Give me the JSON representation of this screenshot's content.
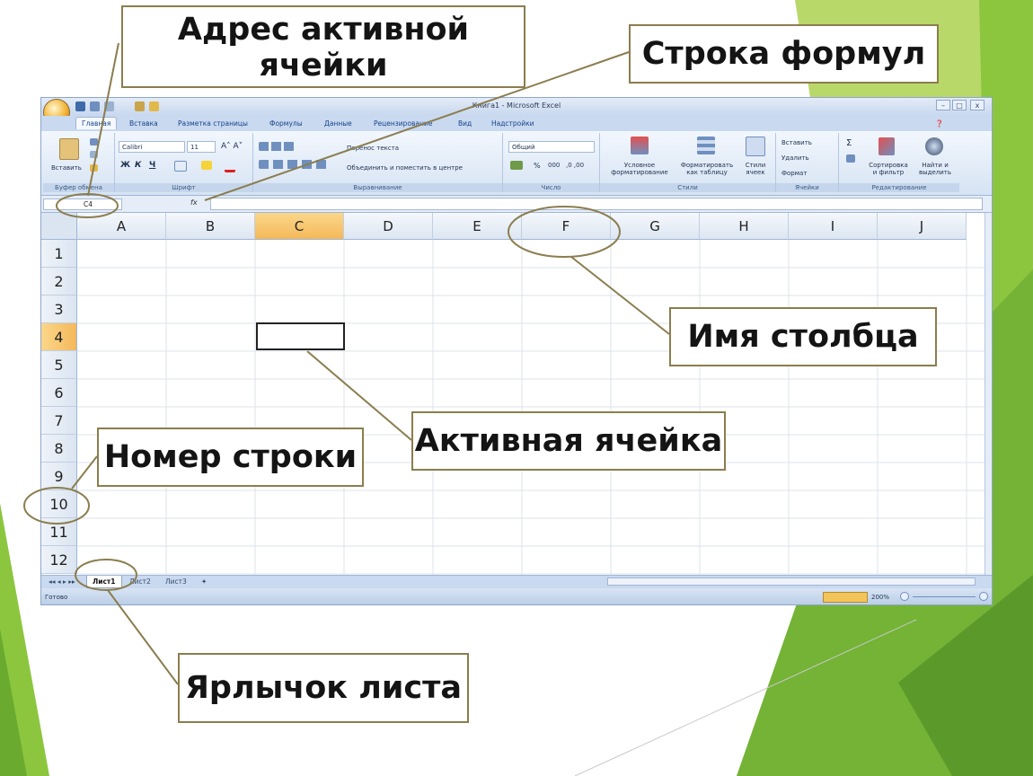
{
  "callouts": {
    "active_cell_address": "Адрес активной ячейки",
    "formula_bar": "Строка формул",
    "column_name": "Имя столбца",
    "active_cell": "Активная ячейка",
    "row_number": "Номер строки",
    "sheet_tab": "Ярлычок листа"
  },
  "window": {
    "title": "Книга1 - Microsoft Excel",
    "minimize": "–",
    "maximize": "□",
    "close": "x"
  },
  "ribbon_tabs": [
    "Главная",
    "Вставка",
    "Разметка страницы",
    "Формулы",
    "Данные",
    "Рецензирование",
    "Вид",
    "Надстройки"
  ],
  "ribbon": {
    "clipboard": {
      "paste": "Вставить",
      "label": "Буфер обмена"
    },
    "font": {
      "name": "Calibri",
      "size": "11",
      "bold": "Ж",
      "italic": "К",
      "underline": "Ч",
      "label": "Шрифт"
    },
    "alignment": {
      "wrap": "Перенос текста",
      "merge": "Объединить и поместить в центре",
      "label": "Выравнивание"
    },
    "number": {
      "format": "Общий",
      "percent": "%",
      "thousands": "000",
      "label": "Число"
    },
    "styles": {
      "conditional": "Условное форматирование",
      "as_table": "Форматировать как таблицу",
      "cell_styles": "Стили ячеек",
      "label": "Стили"
    },
    "cells": {
      "insert": "Вставить",
      "delete": "Удалить",
      "format": "Формат",
      "label": "Ячейки"
    },
    "editing": {
      "sum": "Σ",
      "sort": "Сортировка и фильтр",
      "find": "Найти и выделить",
      "label": "Редактирование"
    }
  },
  "formula_bar": {
    "name_box": "C4",
    "fx": "fx",
    "value": ""
  },
  "grid": {
    "columns": [
      "A",
      "B",
      "C",
      "D",
      "E",
      "F",
      "G",
      "H",
      "I",
      "J"
    ],
    "rows": [
      "1",
      "2",
      "3",
      "4",
      "5",
      "6",
      "7",
      "8",
      "9",
      "10",
      "11",
      "12"
    ],
    "selected_column": "C",
    "selected_row": "4"
  },
  "sheets": [
    "Лист1",
    "Лист2",
    "Лист3"
  ],
  "active_sheet": "Лист1",
  "status": {
    "ready": "Готово",
    "zoom": "200%"
  },
  "colors": {
    "callout_border": "#8b7d4e",
    "green_light": "#b5d55f",
    "green_dark": "#6aaa2e",
    "selection": "#f4b85a"
  }
}
